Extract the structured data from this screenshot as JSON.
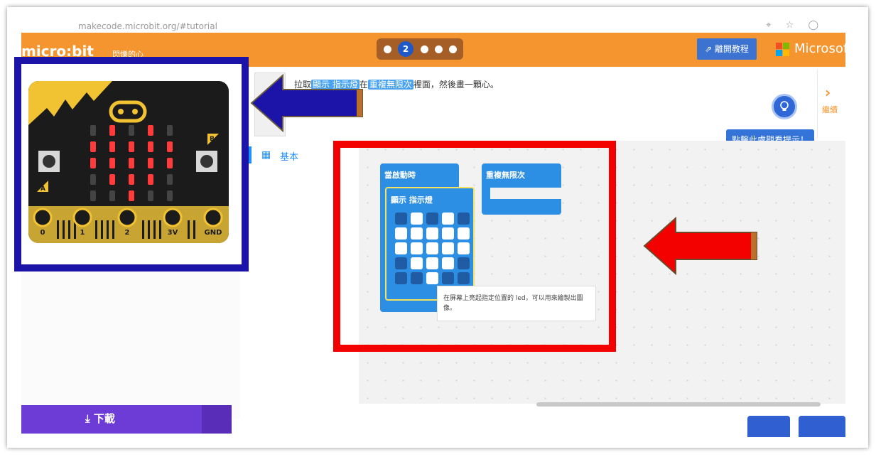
{
  "browser": {
    "url": "makecode.microbit.org/#tutorial",
    "icons": "⌖ ☆ ◯"
  },
  "header": {
    "logo": "micro:bit",
    "project_name": "閃爍的心",
    "current_step": "2",
    "exit_label": "離開教程",
    "brand": "Microsoft"
  },
  "instruction": {
    "parts": [
      "拉取",
      "顯示 指示燈",
      "在",
      "重複無限次",
      "裡面，然後畫一顆心。"
    ]
  },
  "hint": {
    "tooltip": "點擊此處觀看提示！"
  },
  "continue": {
    "label": "繼續"
  },
  "toolbox": {
    "category": "基本",
    "category_icon": "grid-icon"
  },
  "blocks": {
    "on_start": "當啟動時",
    "show_leds": "顯示 指示燈",
    "forever": "重複無限次",
    "leds": [
      [
        0,
        1,
        0,
        1,
        0
      ],
      [
        1,
        1,
        1,
        1,
        1
      ],
      [
        1,
        1,
        1,
        1,
        1
      ],
      [
        0,
        1,
        1,
        1,
        0
      ],
      [
        0,
        0,
        1,
        0,
        0
      ]
    ],
    "tooltip": "在屏幕上亮起指定位置的 led，可以用來繪製出圖像。"
  },
  "simulator": {
    "pins": [
      "0",
      "1",
      "2",
      "3V",
      "GND"
    ],
    "button_a": "A",
    "button_b": "B"
  },
  "download": {
    "label": "下載"
  },
  "colors": {
    "orange": "#f5952f",
    "block_blue": "#2d8fe3",
    "annotation_blue": "#1c14a8",
    "annotation_red": "#f30000",
    "led_red": "#ff3b3b"
  }
}
